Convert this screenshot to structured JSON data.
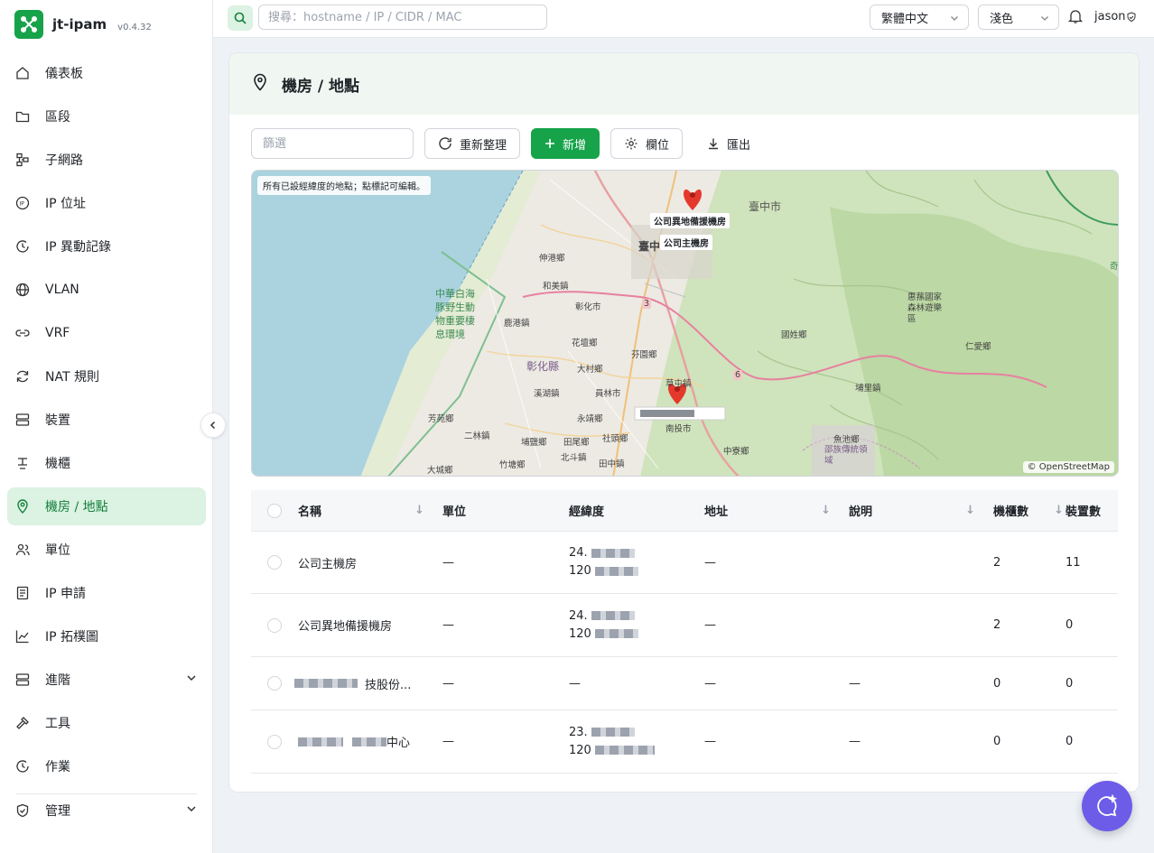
{
  "app": {
    "name": "jt-ipam",
    "version": "v0.4.32"
  },
  "nav": {
    "items": [
      {
        "label": "儀表板",
        "icon": "home-icon"
      },
      {
        "label": "區段",
        "icon": "folder-icon"
      },
      {
        "label": "子網路",
        "icon": "network-icon"
      },
      {
        "label": "IP 位址",
        "icon": "ip-icon"
      },
      {
        "label": "IP 異動記錄",
        "icon": "history-icon"
      },
      {
        "label": "VLAN",
        "icon": "globe-icon"
      },
      {
        "label": "VRF",
        "icon": "link-icon"
      },
      {
        "label": "NAT 規則",
        "icon": "refresh-icon"
      },
      {
        "label": "裝置",
        "icon": "server-icon"
      },
      {
        "label": "機櫃",
        "icon": "rack-icon"
      },
      {
        "label": "機房 / 地點",
        "icon": "location-pin-icon"
      },
      {
        "label": "單位",
        "icon": "users-icon"
      },
      {
        "label": "IP 申請",
        "icon": "document-icon"
      },
      {
        "label": "IP 拓樸圖",
        "icon": "chart-line-icon"
      },
      {
        "label": "進階",
        "icon": "server-icon"
      },
      {
        "label": "工具",
        "icon": "hammer-icon"
      },
      {
        "label": "作業",
        "icon": "history-icon"
      },
      {
        "label": "管理",
        "icon": "shield-icon"
      }
    ]
  },
  "topbar": {
    "search_placeholder": "搜尋：hostname / IP / CIDR / MAC",
    "language": "繁體中文",
    "theme": "淺色",
    "user": "jason"
  },
  "page": {
    "title": "機房 / 地點",
    "filter_placeholder": "篩選",
    "refresh_label": "重新整理",
    "add_label": "新增",
    "columns_label": "欄位",
    "export_label": "匯出"
  },
  "map": {
    "note": "所有已設經緯度的地點；點標記可編輯。",
    "attribution": "© OpenStreetMap",
    "marker1": "公司異地備援機房",
    "marker2": "公司主機房",
    "places": [
      "臺中市",
      "臺中",
      "伸港鄉",
      "和美鎮",
      "彰化市",
      "鹿港鎮",
      "花壇鄉",
      "芬園鄉",
      "彰化縣",
      "大村鄉",
      "溪湖鎮",
      "員林市",
      "永靖鄉",
      "芳苑鄉",
      "二林鎮",
      "埔鹽鄉",
      "田尾鄉",
      "社頭鄉",
      "北斗鎮",
      "竹塘鄉",
      "大城鄉",
      "田中鎮",
      "草屯鎮",
      "南投市",
      "中寮鄉",
      "國姓鄉",
      "埔里鎮",
      "仁愛鄉",
      "魚池鄉",
      "邵族傳統領域",
      "惠蓀國家森林遊樂區",
      "中華白海豚野生動物重要棲息環境",
      "3",
      "6",
      "奇"
    ]
  },
  "table": {
    "headers": [
      "名稱",
      "單位",
      "經緯度",
      "地址",
      "說明",
      "機櫃數",
      "裝置數"
    ],
    "rows": [
      {
        "name": "公司主機房",
        "unit": "—",
        "lat": "24.",
        "lng": "120",
        "address": "—",
        "desc": "",
        "racks": "2",
        "devices": "11"
      },
      {
        "name": "公司異地備援機房",
        "unit": "—",
        "lat": "24.",
        "lng": "120",
        "address": "—",
        "desc": "",
        "racks": "2",
        "devices": "0"
      },
      {
        "name": "技股份...",
        "unit": "—",
        "coord": "—",
        "address": "—",
        "desc": "—",
        "racks": "0",
        "devices": "0"
      },
      {
        "name": "中心",
        "unit": "—",
        "lat": "23.",
        "lng": "120",
        "address": "—",
        "desc": "—",
        "racks": "0",
        "devices": "0"
      }
    ]
  },
  "colors": {
    "accent": "#16a34a",
    "active_bg": "#dcf2e2",
    "chat": "#6d5ce8"
  }
}
